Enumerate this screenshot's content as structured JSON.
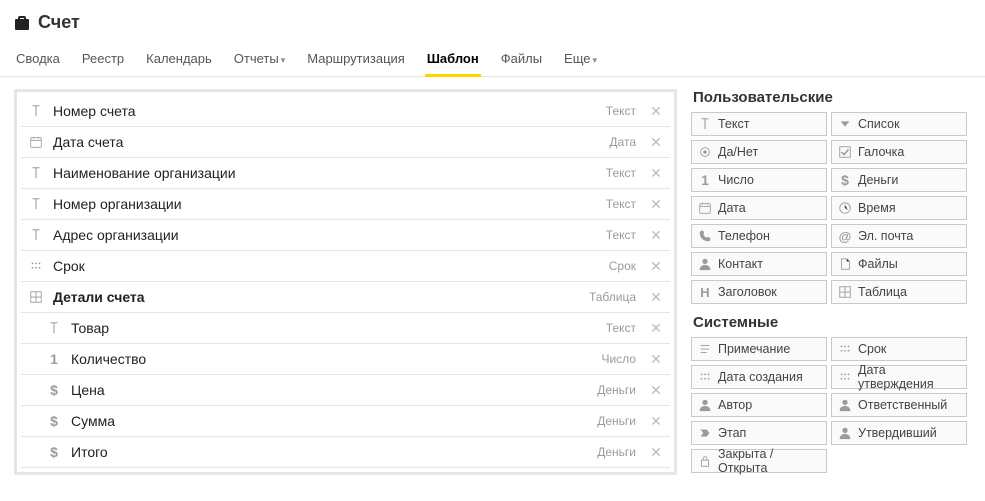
{
  "header": {
    "title": "Счет"
  },
  "tabs": [
    {
      "label": "Сводка",
      "dropdown": false
    },
    {
      "label": "Реестр",
      "dropdown": false
    },
    {
      "label": "Календарь",
      "dropdown": false
    },
    {
      "label": "Отчеты",
      "dropdown": true
    },
    {
      "label": "Маршрутизация",
      "dropdown": false
    },
    {
      "label": "Шаблон",
      "dropdown": false,
      "active": true
    },
    {
      "label": "Файлы",
      "dropdown": false
    },
    {
      "label": "Еще",
      "dropdown": true
    }
  ],
  "fields": [
    {
      "label": "Номер счета",
      "type": "Текст",
      "icon": "text",
      "nested": false,
      "heading": false
    },
    {
      "label": "Дата счета",
      "type": "Дата",
      "icon": "calendar",
      "nested": false,
      "heading": false
    },
    {
      "label": "Наименование организации",
      "type": "Текст",
      "icon": "text",
      "nested": false,
      "heading": false
    },
    {
      "label": "Номер организации",
      "type": "Текст",
      "icon": "text",
      "nested": false,
      "heading": false
    },
    {
      "label": "Адрес организации",
      "type": "Текст",
      "icon": "text",
      "nested": false,
      "heading": false
    },
    {
      "label": "Срок",
      "type": "Срок",
      "icon": "deadline",
      "nested": false,
      "heading": false
    },
    {
      "label": "Детали счета",
      "type": "Таблица",
      "icon": "table",
      "nested": false,
      "heading": true
    },
    {
      "label": "Товар",
      "type": "Текст",
      "icon": "text",
      "nested": true,
      "heading": false
    },
    {
      "label": "Количество",
      "type": "Число",
      "icon": "number",
      "nested": true,
      "heading": false
    },
    {
      "label": "Цена",
      "type": "Деньги",
      "icon": "money",
      "nested": true,
      "heading": false
    },
    {
      "label": "Сумма",
      "type": "Деньги",
      "icon": "money",
      "nested": true,
      "heading": false
    },
    {
      "label": "Итого",
      "type": "Деньги",
      "icon": "money",
      "nested": true,
      "heading": false
    }
  ],
  "sidebar": {
    "groups": [
      {
        "title": "Пользовательские",
        "chips": [
          {
            "label": "Текст",
            "icon": "text"
          },
          {
            "label": "Список",
            "icon": "dropdown"
          },
          {
            "label": "Да/Нет",
            "icon": "radio"
          },
          {
            "label": "Галочка",
            "icon": "check"
          },
          {
            "label": "Число",
            "icon": "number"
          },
          {
            "label": "Деньги",
            "icon": "money"
          },
          {
            "label": "Дата",
            "icon": "calendar"
          },
          {
            "label": "Время",
            "icon": "clock"
          },
          {
            "label": "Телефон",
            "icon": "phone"
          },
          {
            "label": "Эл. почта",
            "icon": "at"
          },
          {
            "label": "Контакт",
            "icon": "person"
          },
          {
            "label": "Файлы",
            "icon": "file"
          },
          {
            "label": "Заголовок",
            "icon": "heading"
          },
          {
            "label": "Таблица",
            "icon": "table"
          }
        ]
      },
      {
        "title": "Системные",
        "chips": [
          {
            "label": "Примечание",
            "icon": "note"
          },
          {
            "label": "Срок",
            "icon": "deadline"
          },
          {
            "label": "Дата создания",
            "icon": "dotgrid"
          },
          {
            "label": "Дата утверждения",
            "icon": "dotgrid"
          },
          {
            "label": "Автор",
            "icon": "person"
          },
          {
            "label": "Ответственный",
            "icon": "person"
          },
          {
            "label": "Этап",
            "icon": "arrow"
          },
          {
            "label": "Утвердивший",
            "icon": "person"
          },
          {
            "label": "Закрыта / Открыта",
            "icon": "lock"
          }
        ]
      }
    ]
  }
}
